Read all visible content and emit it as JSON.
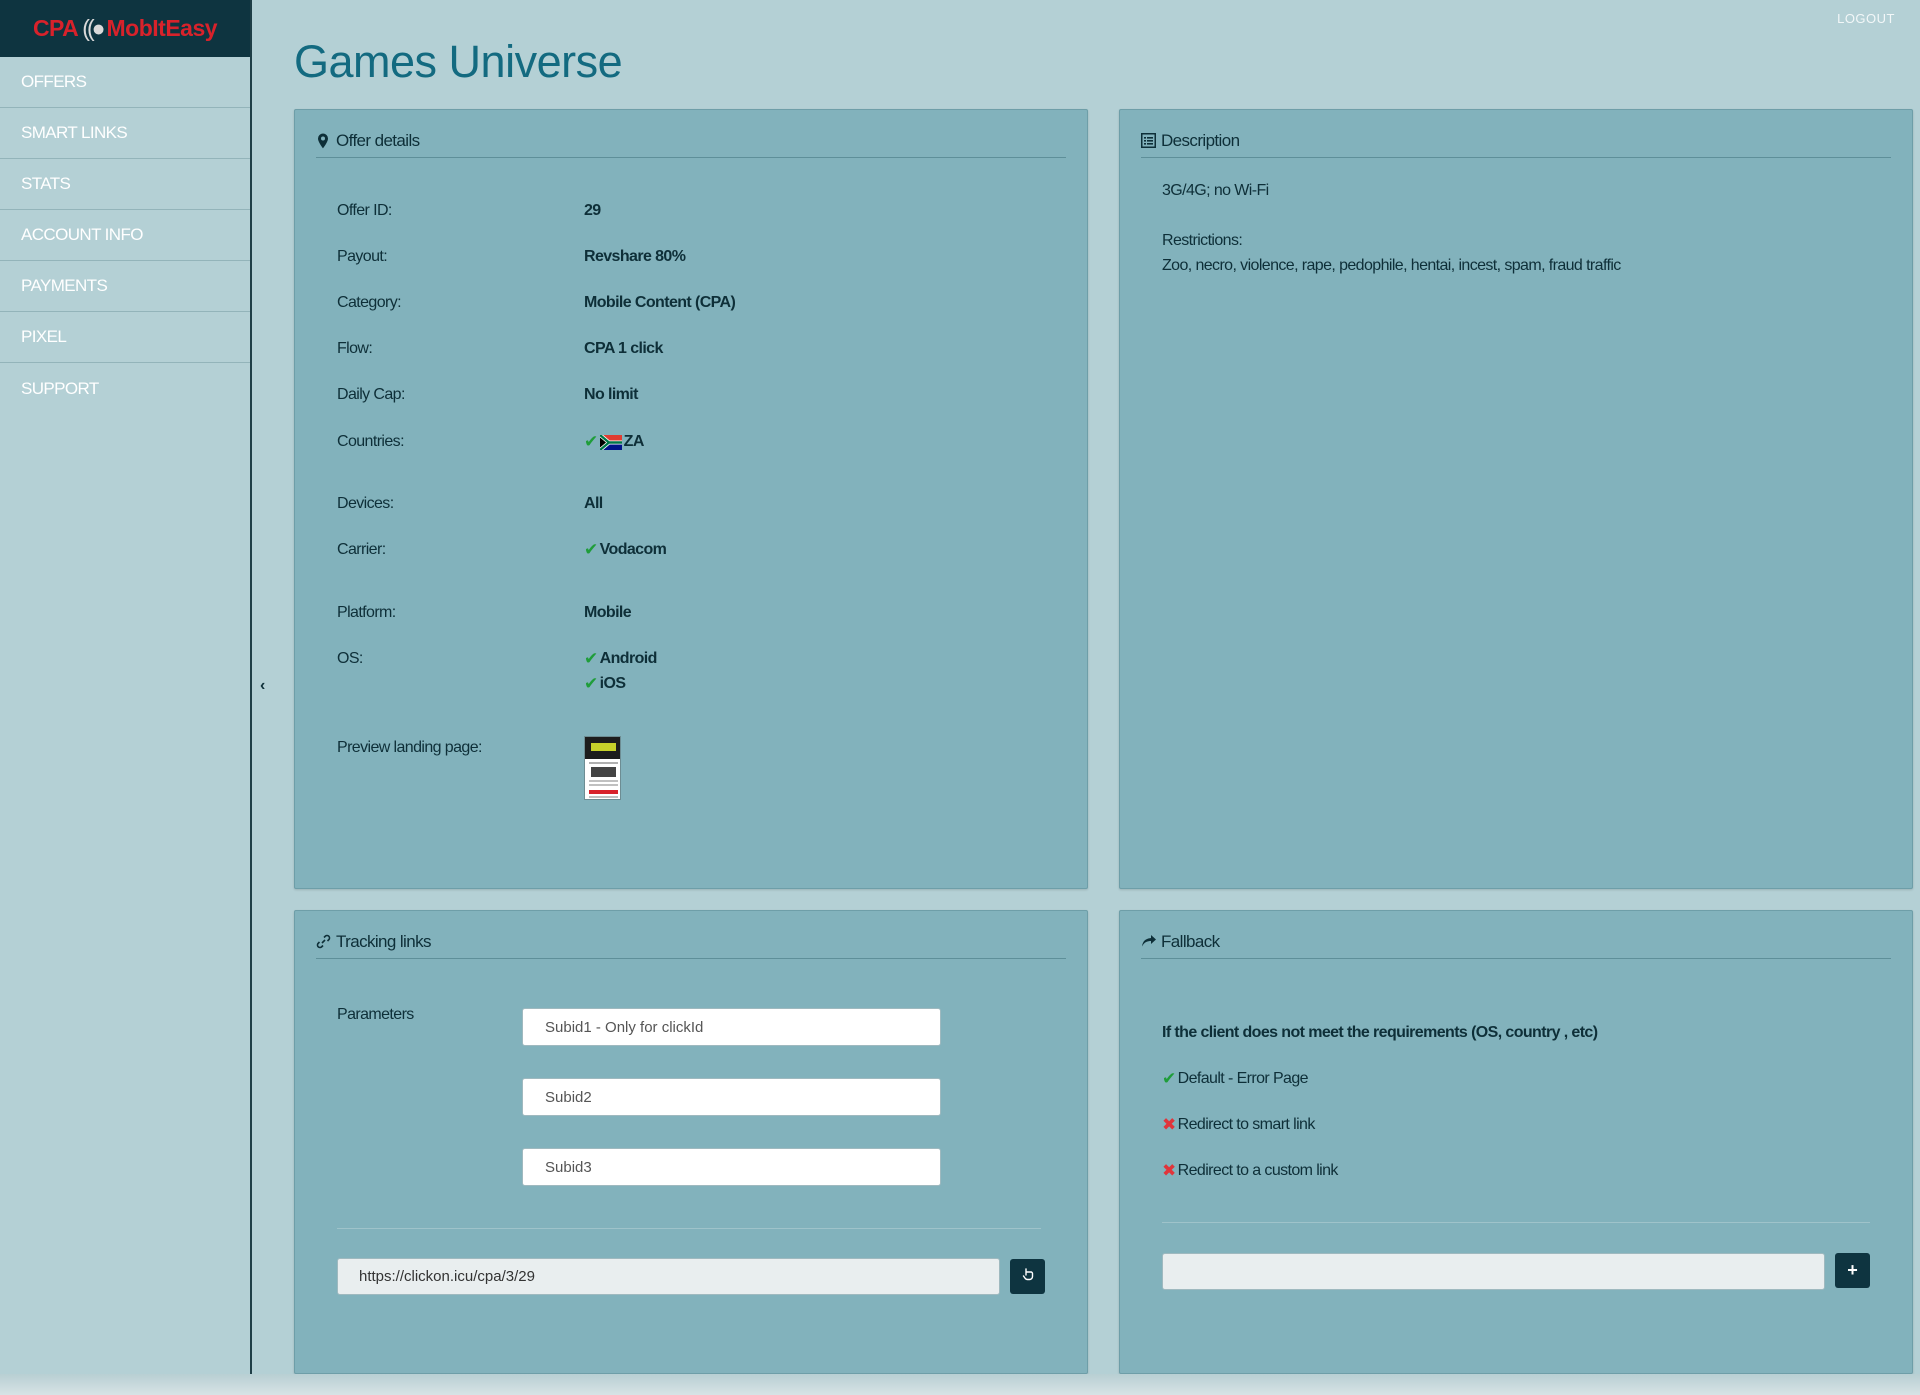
{
  "logo": {
    "part1": "CPA",
    "waves": "((●",
    "part2": "MobIt",
    "part3": "Easy"
  },
  "sidebar": {
    "items": [
      {
        "label": "OFFERS"
      },
      {
        "label": "SMART LINKS"
      },
      {
        "label": "STATS"
      },
      {
        "label": "ACCOUNT INFO"
      },
      {
        "label": "PAYMENTS"
      },
      {
        "label": "PIXEL"
      },
      {
        "label": "SUPPORT"
      }
    ]
  },
  "header": {
    "logout": "LOGOUT",
    "title": "Games Universe"
  },
  "offer_details": {
    "heading": "Offer details",
    "offer_id": {
      "label": "Offer ID:",
      "value": "29"
    },
    "payout": {
      "label": "Payout:",
      "value": "Revshare 80%"
    },
    "category": {
      "label": "Category:",
      "value": "Mobile Content (CPA)"
    },
    "flow": {
      "label": "Flow:",
      "value": "CPA 1 click"
    },
    "daily_cap": {
      "label": "Daily Cap:",
      "value": "No limit"
    },
    "countries": {
      "label": "Countries:",
      "value": "ZA"
    },
    "devices": {
      "label": "Devices:",
      "value": "All"
    },
    "carrier": {
      "label": "Carrier:",
      "value": "Vodacom"
    },
    "platform": {
      "label": "Platform:",
      "value": "Mobile"
    },
    "os": {
      "label": "OS:",
      "values": [
        "Android",
        "iOS"
      ]
    },
    "preview": {
      "label": "Preview landing page:"
    }
  },
  "description": {
    "heading": "Description",
    "line1": "3G/4G; no Wi-Fi",
    "restrictions_label": "Restrictions:",
    "restrictions": "Zoo, necro, violence, rape, pedophile, hentai, incest, spam, fraud traffic"
  },
  "tracking": {
    "heading": "Tracking links",
    "parameters_label": "Parameters",
    "subid1_placeholder": "Subid1 - Only for clickId",
    "subid2_placeholder": "Subid2",
    "subid3_placeholder": "Subid3",
    "url": "https://clickon.icu/cpa/3/29"
  },
  "fallback": {
    "heading": "Fallback",
    "title": "If the client does not meet the requirements (OS, country , etc)",
    "options": [
      {
        "label": "Default - Error Page",
        "selected": true
      },
      {
        "label": "Redirect to smart link",
        "selected": false
      },
      {
        "label": "Redirect to a custom link",
        "selected": false
      }
    ],
    "add_symbol": "+"
  },
  "colors": {
    "accent": "#136a80",
    "panel": "#82b2bc",
    "dark": "#0e3440",
    "check": "#1f9d3a",
    "cross": "#e0353b"
  }
}
